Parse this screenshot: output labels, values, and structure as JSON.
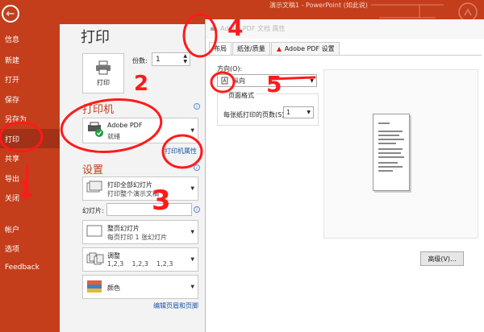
{
  "window": {
    "title": "演示文稿1 - PowerPoint (如此说)"
  },
  "nav": {
    "back_glyph": "←",
    "items": [
      "信息",
      "新建",
      "打开",
      "保存",
      "另存为",
      "打印",
      "共享",
      "导出",
      "关闭",
      "帐户",
      "选项",
      "Feedback"
    ],
    "active": "打印"
  },
  "print": {
    "title": "打印",
    "print_button": "打印",
    "copies_label": "份数:",
    "copies_value": "1"
  },
  "printer": {
    "heading": "打印机",
    "name": "Adobe PDF",
    "status": "就绪",
    "properties_link": "打印机属性"
  },
  "settings": {
    "heading": "设置",
    "range_main": "打印全部幻灯片",
    "range_sub": "打印整个演示文稿",
    "slides_label": "幻灯片:",
    "layout_main": "整页幻灯片",
    "layout_sub": "每页打印 1 张幻灯片",
    "collate_main": "调整",
    "collate_sub": "1,2,3    1,2,3    1,2,3",
    "color_main": "颜色",
    "header_footer_link": "编辑页眉和页脚"
  },
  "dialog": {
    "title": "Adobe PDF 文档 属性",
    "tabs": [
      "布局",
      "纸张/质量",
      "Adobe PDF 设置"
    ],
    "active_tab": "布局",
    "orientation_label": "方向(O):",
    "orientation_value": "纵向",
    "page_format_label": "页面格式",
    "pages_per_sheet_label": "每张纸打印的页数(S)",
    "pages_per_sheet_value": "1",
    "advanced_button": "高级(V)..."
  },
  "annotations": [
    "1",
    "2",
    "3",
    "4",
    "5"
  ],
  "colors": {
    "accent": "#c43e1c",
    "annotation": "#ff1a1a",
    "link": "#1a55a8"
  }
}
